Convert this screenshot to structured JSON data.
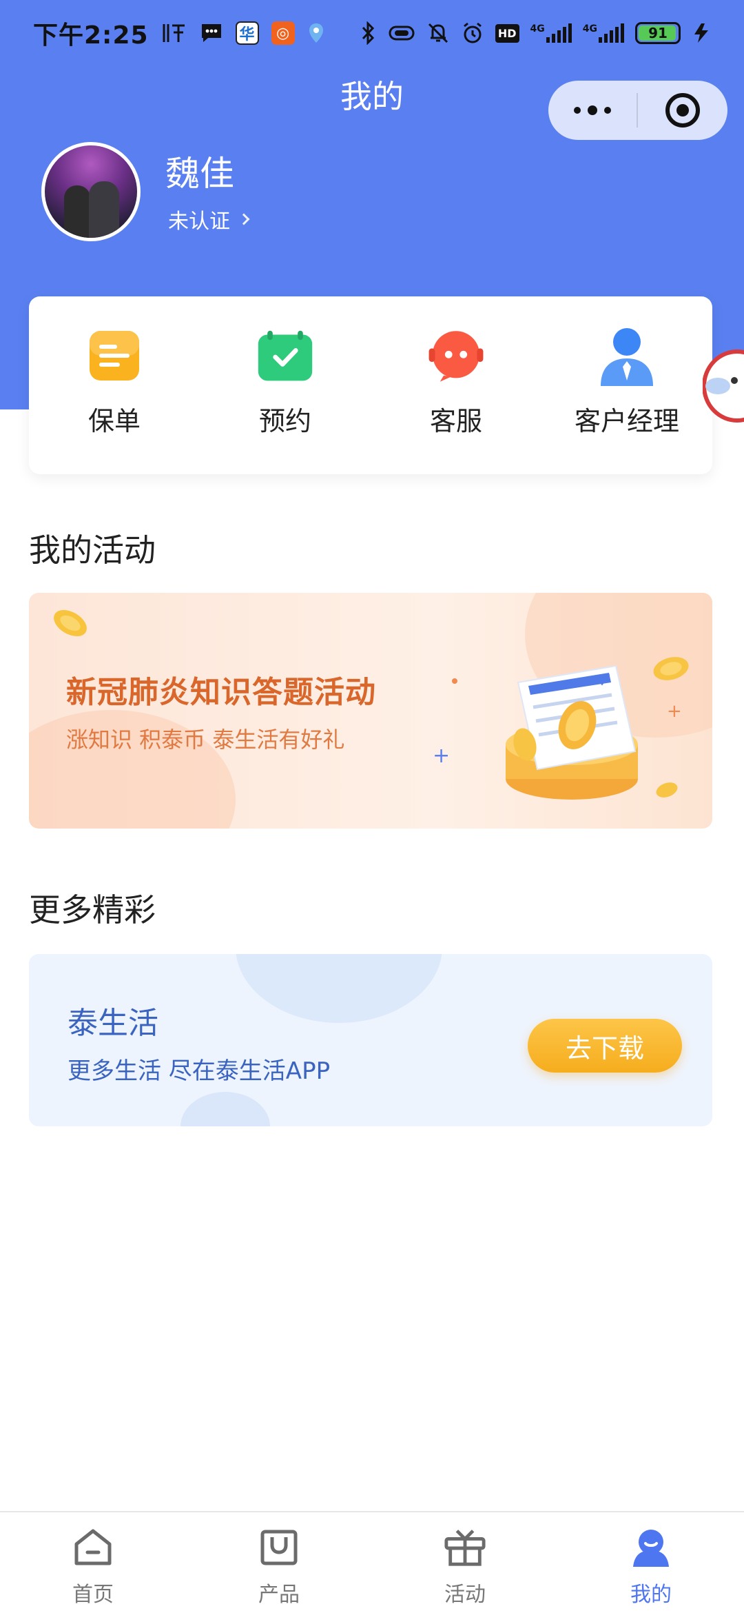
{
  "status_bar": {
    "time": "下午2:25",
    "hd_label": "HD",
    "net_label_1": "4G",
    "net_label_2": "4G",
    "battery": "91"
  },
  "header": {
    "title": "我的"
  },
  "profile": {
    "name": "魏佳",
    "verify_status": "未认证"
  },
  "quick_menu": {
    "items": [
      {
        "label": "保单",
        "icon": "policy-icon",
        "color": "#fbb21f"
      },
      {
        "label": "预约",
        "icon": "calendar-check-icon",
        "color": "#2fcb7d"
      },
      {
        "label": "客服",
        "icon": "service-robot-icon",
        "color": "#fb5a42"
      },
      {
        "label": "客户经理",
        "icon": "manager-icon",
        "color": "#3d86f5"
      }
    ]
  },
  "my_activities": {
    "title": "我的活动",
    "banner": {
      "title": "新冠肺炎知识答题活动",
      "subtitle": "涨知识 积泰币 泰生活有好礼"
    }
  },
  "more": {
    "title": "更多精彩",
    "card": {
      "title": "泰生活",
      "subtitle": "更多生活 尽在泰生活APP",
      "button": "去下载"
    }
  },
  "tab_bar": {
    "items": [
      {
        "label": "首页",
        "icon": "home-icon",
        "active": false
      },
      {
        "label": "产品",
        "icon": "bag-icon",
        "active": false
      },
      {
        "label": "活动",
        "icon": "gift-icon",
        "active": false
      },
      {
        "label": "我的",
        "icon": "profile-icon",
        "active": true
      }
    ]
  },
  "colors": {
    "header_blue": "#5a7ff0",
    "accent_orange": "#d9662a",
    "active_tab": "#4e76f0"
  }
}
